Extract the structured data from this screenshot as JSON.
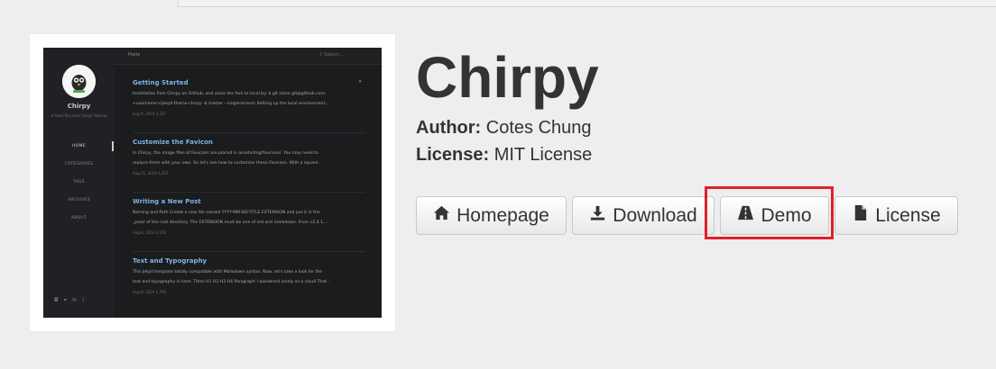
{
  "theme": {
    "name": "Chirpy",
    "author_label": "Author:",
    "author": "Cotes Chung",
    "license_label": "License:",
    "license": "MIT License"
  },
  "actions": [
    {
      "id": "homepage",
      "label": "Homepage",
      "icon": "home-icon"
    },
    {
      "id": "download",
      "label": "Download",
      "icon": "download-icon"
    },
    {
      "id": "demo",
      "label": "Demo",
      "icon": "road-icon"
    },
    {
      "id": "license",
      "label": "License",
      "icon": "file-icon"
    }
  ],
  "highlight_color": "#e0202a",
  "preview": {
    "site_title": "Chirpy",
    "site_subtitle": "A text-focused Jekyll theme",
    "nav": [
      "HOME",
      "CATEGORIES",
      "TAGS",
      "ARCHIVES",
      "ABOUT"
    ],
    "topbar_label": "Posts",
    "search_placeholder": "Search...",
    "posts": [
      {
        "title": "Getting Started",
        "excerpt1": "Installation Fork Chirpy on GitHub, and clone the fork to local by: $ git clone git@github.com:",
        "excerpt2": "<username>/jekyll-theme-chirpy -b master --single-branch Setting up the local environment...",
        "meta": "Aug 9, 2019     3,321"
      },
      {
        "title": "Customize the Favicon",
        "excerpt1": "In Chirpy, the image files of Favicons are placed in assets/img/favicons/. You may need to",
        "excerpt2": "replace them with your own. So let's see how to customize these Favicons. With a square...",
        "meta": "Aug 11, 2019     1,337"
      },
      {
        "title": "Writing a New Post",
        "excerpt1": "Naming and Path Create a new file named YYYY-MM-DD-TITLE.EXTENSION and put it in the",
        "excerpt2": "_post/ of the root directory. The EXTENSION must be one of md and markdown. From v2.4.1,...",
        "meta": "Aug 8, 2019     2,036"
      },
      {
        "title": "Text and Typography",
        "excerpt1": "This Jekyll template totally compatible with Markdown syntax. Now, let's take a look for the",
        "excerpt2": "text and typography in here. Titles H1 H2 H3 H4 Paragraph I wandered lonely as a cloud That...",
        "meta": "Aug 8, 2019     1,766"
      }
    ]
  }
}
